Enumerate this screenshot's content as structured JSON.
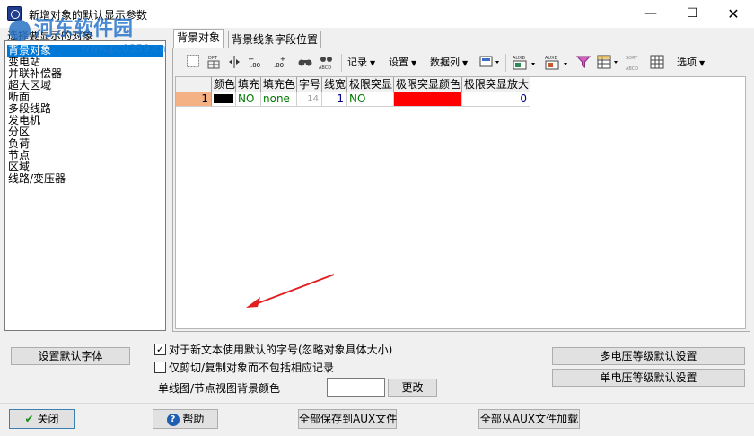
{
  "window": {
    "title": "新增对象的默认显示参数",
    "minimize_glyph": "—",
    "maximize_glyph": "☐",
    "close_glyph": "✕"
  },
  "watermark": {
    "brand": "河东软件园",
    "url": "www.pc0359.cn"
  },
  "left": {
    "label": "选择要显示的对象",
    "items": [
      "背景对象",
      "变电站",
      "并联补偿器",
      "超大区域",
      "断面",
      "多段线路",
      "发电机",
      "分区",
      "负荷",
      "节点",
      "区域",
      "线路/变压器"
    ],
    "selected_index": 0
  },
  "tabs": [
    {
      "label": "背景对象",
      "active": true
    },
    {
      "label": "背景线条字段位置",
      "active": false
    }
  ],
  "toolbar": {
    "icons": [
      "grid-select-icon",
      "dpt-icon",
      "split-columns-icon",
      "decrease-decimal-icon",
      "increase-decimal-icon",
      "find-icon",
      "find-replace-icon",
      "filter-icon",
      "table-icon"
    ],
    "decimal_minus_label": ".00",
    "decimal_plus_label": ".00",
    "dpt_label": "DPT",
    "abcd_label": "ABCD",
    "aux_label": "AUXB",
    "sort_label": "SORT",
    "records_label": "记录",
    "settings_label": "设置",
    "data_columns_label": "数据列",
    "options_label": "选项"
  },
  "grid": {
    "headers": [
      "颜色",
      "填充",
      "填充色",
      "字号",
      "线宽",
      "极限突显",
      "极限突显颜色",
      "极限突显放大"
    ],
    "rows": [
      {
        "row_number": "1",
        "color": "#000000",
        "fill": "NO",
        "fill_color": "none",
        "font_size": "14",
        "line_width": "1",
        "limit_highlight": "NO",
        "limit_highlight_color": "#ff0000",
        "limit_highlight_zoom": "0"
      }
    ]
  },
  "bottom": {
    "set_default_font_label": "设置默认字体",
    "checkbox1_label": "对于新文本使用默认的字号(忽略对象具体大小)",
    "checkbox1_checked": true,
    "checkbox1_mark": "✓",
    "checkbox2_label": "仅剪切/复制对象而不包括相应记录",
    "checkbox2_checked": false,
    "bg_color_label": "单线图/节点视图背景颜色",
    "bg_color_value": "#ffffff",
    "change_label": "更改",
    "multi_voltage_label": "多电压等级默认设置",
    "single_voltage_label": "单电压等级默认设置"
  },
  "footer": {
    "close_label": "关闭",
    "close_icon_glyph": "✔",
    "help_label": "帮助",
    "help_icon_glyph": "?",
    "save_aux_label": "全部保存到AUX文件",
    "load_aux_label": "全部从AUX文件加载"
  },
  "colors": {
    "selection_blue": "#0078d7",
    "highlight_red": "#ff0000",
    "row_header_orange": "#f4b183",
    "green_text": "#007a00",
    "arrow_red": "#e02020"
  }
}
